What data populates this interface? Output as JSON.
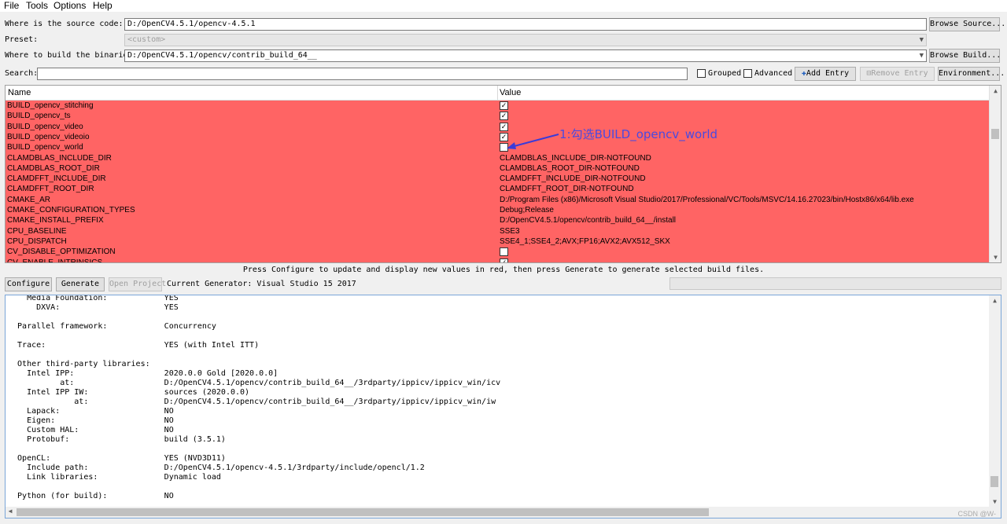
{
  "menu": [
    "File",
    "Tools",
    "Options",
    "Help"
  ],
  "source": {
    "label": "Where is the source code:",
    "value": "D:/OpenCV4.5.1/opencv-4.5.1",
    "button": "Browse Source..."
  },
  "preset": {
    "label": "Preset:",
    "value": "<custom>"
  },
  "build": {
    "label": "Where to build the binaries:",
    "value": "D:/OpenCV4.5.1/opencv/contrib_build_64__",
    "button": "Browse Build..."
  },
  "search": {
    "label": "Search:",
    "value": ""
  },
  "options": {
    "grouped": "Grouped",
    "advanced": "Advanced",
    "add_entry": "Add Entry",
    "remove_entry": "Remove Entry",
    "environment": "Environment..."
  },
  "table": {
    "col_name": "Name",
    "col_value": "Value",
    "rows": [
      {
        "name": "BUILD_opencv_stitching",
        "value": "",
        "checkbox": true,
        "checked": true
      },
      {
        "name": "BUILD_opencv_ts",
        "value": "",
        "checkbox": true,
        "checked": true
      },
      {
        "name": "BUILD_opencv_video",
        "value": "",
        "checkbox": true,
        "checked": true
      },
      {
        "name": "BUILD_opencv_videoio",
        "value": "",
        "checkbox": true,
        "checked": true
      },
      {
        "name": "BUILD_opencv_world",
        "value": "",
        "checkbox": true,
        "checked": false
      },
      {
        "name": "CLAMDBLAS_INCLUDE_DIR",
        "value": "CLAMDBLAS_INCLUDE_DIR-NOTFOUND",
        "checkbox": false,
        "checked": false
      },
      {
        "name": "CLAMDBLAS_ROOT_DIR",
        "value": "CLAMDBLAS_ROOT_DIR-NOTFOUND",
        "checkbox": false,
        "checked": false
      },
      {
        "name": "CLAMDFFT_INCLUDE_DIR",
        "value": "CLAMDFFT_INCLUDE_DIR-NOTFOUND",
        "checkbox": false,
        "checked": false
      },
      {
        "name": "CLAMDFFT_ROOT_DIR",
        "value": "CLAMDFFT_ROOT_DIR-NOTFOUND",
        "checkbox": false,
        "checked": false
      },
      {
        "name": "CMAKE_AR",
        "value": "D:/Program Files (x86)/Microsoft Visual Studio/2017/Professional/VC/Tools/MSVC/14.16.27023/bin/Hostx86/x64/lib.exe",
        "checkbox": false,
        "checked": false
      },
      {
        "name": "CMAKE_CONFIGURATION_TYPES",
        "value": "Debug;Release",
        "checkbox": false,
        "checked": false
      },
      {
        "name": "CMAKE_INSTALL_PREFIX",
        "value": "D:/OpenCV4.5.1/opencv/contrib_build_64__/install",
        "checkbox": false,
        "checked": false
      },
      {
        "name": "CPU_BASELINE",
        "value": "SSE3",
        "checkbox": false,
        "checked": false
      },
      {
        "name": "CPU_DISPATCH",
        "value": "SSE4_1;SSE4_2;AVX;FP16;AVX2;AVX512_SKX",
        "checkbox": false,
        "checked": false
      },
      {
        "name": "CV_DISABLE_OPTIMIZATION",
        "value": "",
        "checkbox": true,
        "checked": false
      },
      {
        "name": "CV_ENABLE_INTRINSICS",
        "value": "",
        "checkbox": true,
        "checked": true
      }
    ]
  },
  "annotation": "1:勾选BUILD_opencv_world",
  "hint": "Press Configure to update and display new values in red, then press Generate to generate selected build files.",
  "buttons": {
    "configure": "Configure",
    "generate": "Generate",
    "open_project": "Open Project"
  },
  "generator": "Current Generator: Visual Studio 15 2017",
  "output_lines": [
    "    Media Foundation:            YES",
    "      DXVA:                      YES",
    "",
    "  Parallel framework:            Concurrency",
    "",
    "  Trace:                         YES (with Intel ITT)",
    "",
    "  Other third-party libraries:",
    "    Intel IPP:                   2020.0.0 Gold [2020.0.0]",
    "           at:                   D:/OpenCV4.5.1/opencv/contrib_build_64__/3rdparty/ippicv/ippicv_win/icv",
    "    Intel IPP IW:                sources (2020.0.0)",
    "              at:                D:/OpenCV4.5.1/opencv/contrib_build_64__/3rdparty/ippicv/ippicv_win/iw",
    "    Lapack:                      NO",
    "    Eigen:                       NO",
    "    Custom HAL:                  NO",
    "    Protobuf:                    build (3.5.1)",
    "",
    "  OpenCL:                        YES (NVD3D11)",
    "    Include path:                D:/OpenCV4.5.1/opencv-4.5.1/3rdparty/include/opencl/1.2",
    "    Link libraries:              Dynamic load",
    "",
    "  Python (for build):            NO"
  ],
  "watermark": "CSDN @W-"
}
